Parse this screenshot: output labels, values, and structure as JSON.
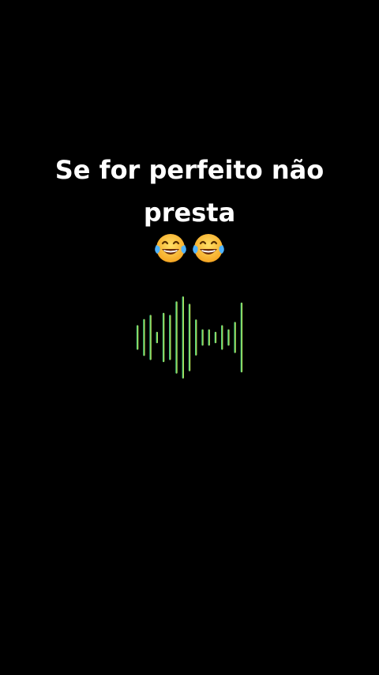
{
  "caption": {
    "line1": "Se for perfeito não",
    "line2": "presta"
  },
  "emojis": [
    "face-with-tears-of-joy-icon",
    "face-with-tears-of-joy-icon"
  ],
  "waveform": {
    "gradient_start": "#2ecc8f",
    "gradient_end": "#d6e84a",
    "bar_levels": [
      0.3,
      0.45,
      0.55,
      0.14,
      0.6,
      0.55,
      0.88,
      1.0,
      0.82,
      0.44,
      0.2,
      0.2,
      0.14,
      0.3,
      0.2,
      0.38,
      0.85
    ]
  }
}
